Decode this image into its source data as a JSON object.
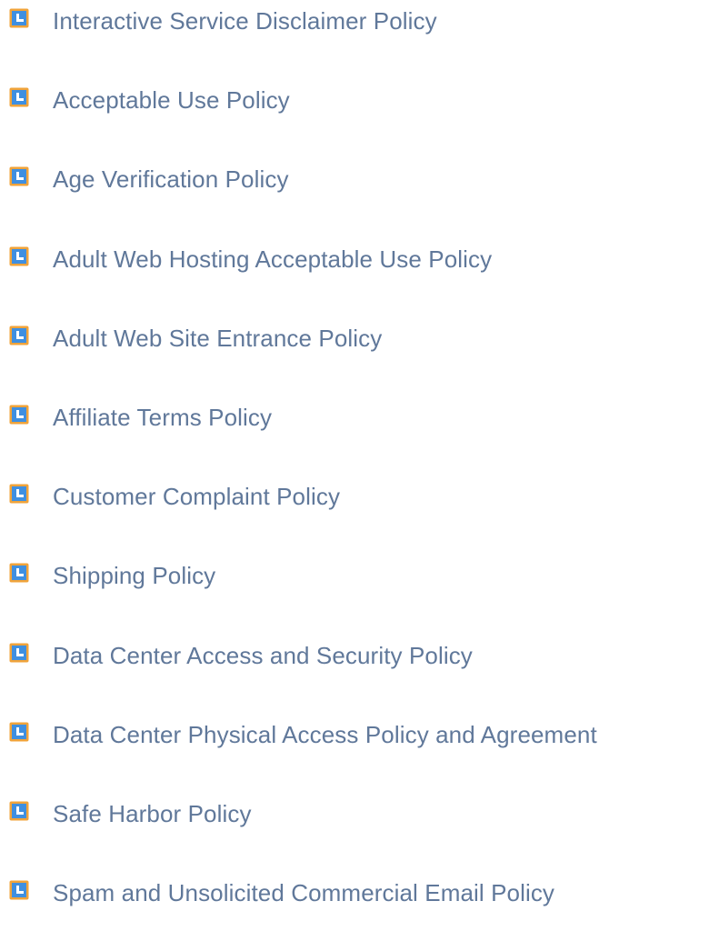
{
  "bullet": {
    "icon": "document-page-icon",
    "colors": {
      "outer": "#f0a33a",
      "inner": "#3f8fe0",
      "highlight": "#ffffff"
    }
  },
  "link_color": "#60789a",
  "policies": [
    "Interactive Service Disclaimer Policy",
    "Acceptable Use Policy",
    "Age Verification Policy",
    "Adult Web Hosting Acceptable Use Policy",
    "Adult Web Site Entrance Policy",
    "Affiliate Terms Policy",
    "Customer Complaint Policy",
    "Shipping Policy",
    "Data Center Access and Security Policy",
    "Data Center Physical Access Policy and Agreement",
    "Safe Harbor Policy",
    "Spam and Unsolicited Commercial Email Policy"
  ]
}
